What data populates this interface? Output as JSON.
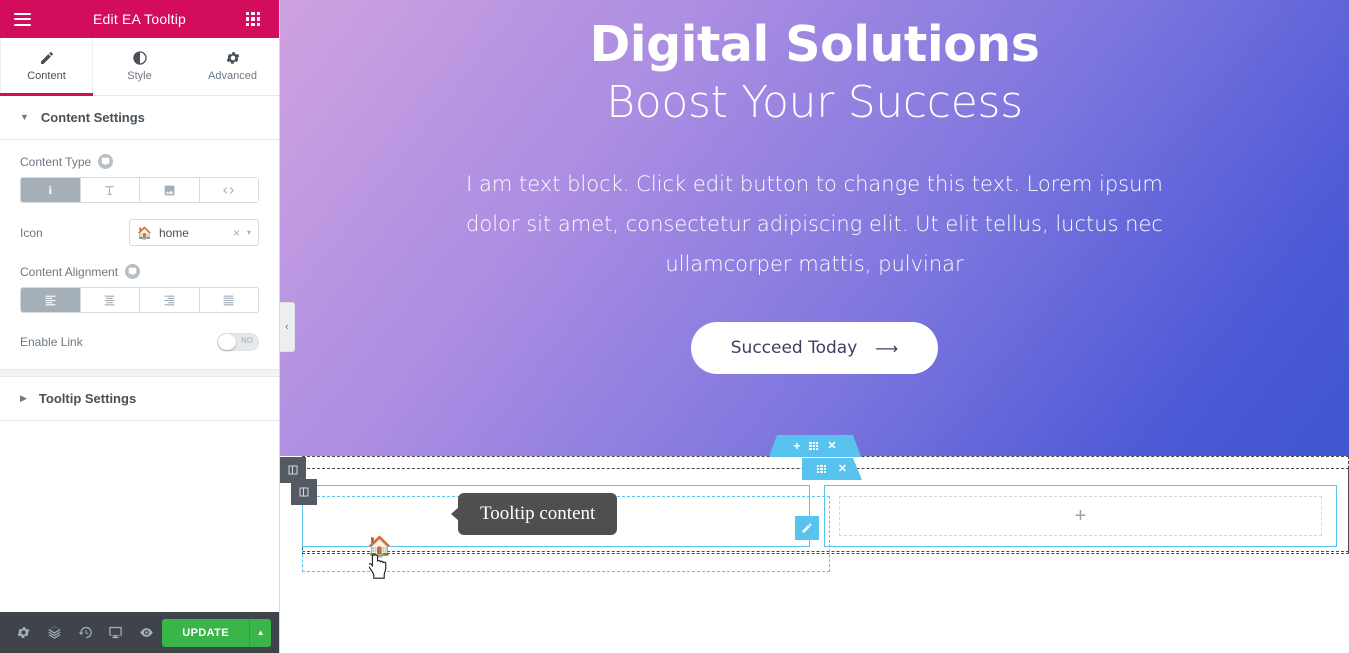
{
  "panel": {
    "header": {
      "title": "Edit EA Tooltip",
      "menu_icon": "hamburger-menu-icon",
      "grid_icon": "widgets-grid-icon"
    },
    "tabs": [
      {
        "label": "Content",
        "icon": "pencil-icon",
        "active": true
      },
      {
        "label": "Style",
        "icon": "contrast-circle-icon",
        "active": false
      },
      {
        "label": "Advanced",
        "icon": "gear-icon",
        "active": false
      }
    ],
    "sections": [
      {
        "label": "Content Settings",
        "expanded": true
      },
      {
        "label": "Tooltip Settings",
        "expanded": false
      }
    ],
    "controls": {
      "content_type": {
        "label": "Content Type",
        "options": [
          {
            "name": "icon",
            "glyph": "i",
            "active": true
          },
          {
            "name": "text",
            "glyph": "T",
            "active": false
          },
          {
            "name": "image",
            "glyph": "image-icon",
            "active": false
          },
          {
            "name": "code",
            "glyph": "</>",
            "active": false
          }
        ]
      },
      "icon": {
        "label": "Icon",
        "value": "home",
        "clear_label": "×",
        "caret": "▾"
      },
      "content_alignment": {
        "label": "Content Alignment",
        "options": [
          {
            "name": "align-left",
            "active": true
          },
          {
            "name": "align-center",
            "active": false
          },
          {
            "name": "align-right",
            "active": false
          },
          {
            "name": "align-justify",
            "active": false
          }
        ]
      },
      "enable_link": {
        "label": "Enable Link",
        "state": "NO"
      }
    },
    "footer": {
      "icons": [
        "settings-gear-icon",
        "navigator-layers-icon",
        "history-revisions-icon",
        "responsive-mode-icon",
        "preview-eye-icon"
      ],
      "update_label": "UPDATE",
      "update_caret": "▲"
    }
  },
  "canvas": {
    "collapse_arrow": "‹",
    "hero": {
      "title": "Digital Solutions",
      "subtitle": "Boost Your Success",
      "paragraph": "I am text block. Click edit button to change this text. Lorem ipsum dolor sit amet, consectetur adipiscing elit. Ut elit tellus, luctus nec ullamcorper mattis, pulvinar",
      "cta_label": "Succeed Today",
      "cta_arrow": "⟶"
    },
    "editor": {
      "section_handle": {
        "add": "+",
        "drag": "drag-grid-icon",
        "close": "✕"
      },
      "inner_handle": {
        "drag": "drag-grid-icon",
        "close": "✕"
      },
      "widget_edit_icon": "pencil-edit-icon",
      "tooltip_trigger_icon": "home-icon",
      "tooltip_text": "Tooltip content",
      "empty_column_add": "+"
    }
  },
  "colors": {
    "panel_header": "#d30c5c",
    "update_button": "#39b54a",
    "editor_accent": "#59c3f0",
    "hero_gradient_start": "#cfa2e0",
    "hero_gradient_end": "#3f56d0",
    "tooltip_bg": "#4f4f4f"
  }
}
